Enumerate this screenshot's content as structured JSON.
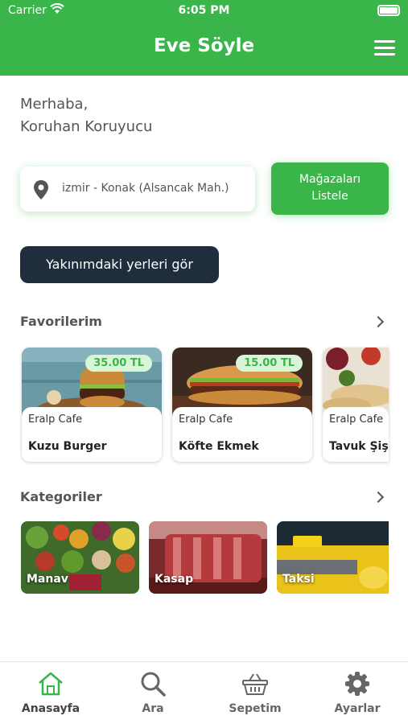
{
  "status_bar": {
    "carrier": "Carrier",
    "time": "6:05 PM"
  },
  "header": {
    "title": "Eve Söyle",
    "menu_icon": "hamburger-menu-icon"
  },
  "greeting": {
    "line1": "Merhaba,",
    "line2": "Koruhan Koruyucu"
  },
  "location": {
    "icon": "location-pin-icon",
    "text": "izmir - Konak (Alsancak Mah.)"
  },
  "list_stores_button": {
    "line1": "Mağazaları",
    "line2": "Listele"
  },
  "nearby_button": {
    "label": "Yakınımdaki yerleri gör"
  },
  "favorites": {
    "title": "Favorilerim",
    "items": [
      {
        "shop": "Eralp Cafe",
        "name": "Kuzu Burger",
        "price": "35.00 TL"
      },
      {
        "shop": "Eralp Cafe",
        "name": "Köfte Ekmek",
        "price": "15.00 TL"
      },
      {
        "shop": "Eralp Cafe",
        "name": "Tavuk Şiş D"
      }
    ]
  },
  "categories": {
    "title": "Kategoriler",
    "items": [
      {
        "label": "Manav"
      },
      {
        "label": "Kasap"
      },
      {
        "label": "Taksi"
      }
    ]
  },
  "tab_bar": {
    "tabs": [
      {
        "label": "Anasayfa",
        "icon": "home-icon"
      },
      {
        "label": "Ara",
        "icon": "search-icon"
      },
      {
        "label": "Sepetim",
        "icon": "basket-icon"
      },
      {
        "label": "Ayarlar",
        "icon": "gear-icon"
      }
    ]
  },
  "colors": {
    "brand_green": "#3ab54a",
    "dark_button": "#1f2d3d",
    "price_badge_bg": "#d8f5d8"
  }
}
